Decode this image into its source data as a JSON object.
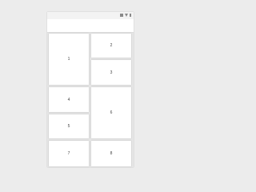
{
  "status_bar": {
    "icons": [
      "signal-icon",
      "wifi-icon",
      "battery-icon"
    ]
  },
  "app_bar": {
    "title": ""
  },
  "grid": {
    "tiles": [
      "1",
      "2",
      "3",
      "4",
      "5",
      "6",
      "7",
      "8"
    ]
  },
  "colors": {
    "background": "#ececec",
    "tile": "#ffffff",
    "divider": "#e5e5e5",
    "status_icon": "#8a8a8a"
  }
}
